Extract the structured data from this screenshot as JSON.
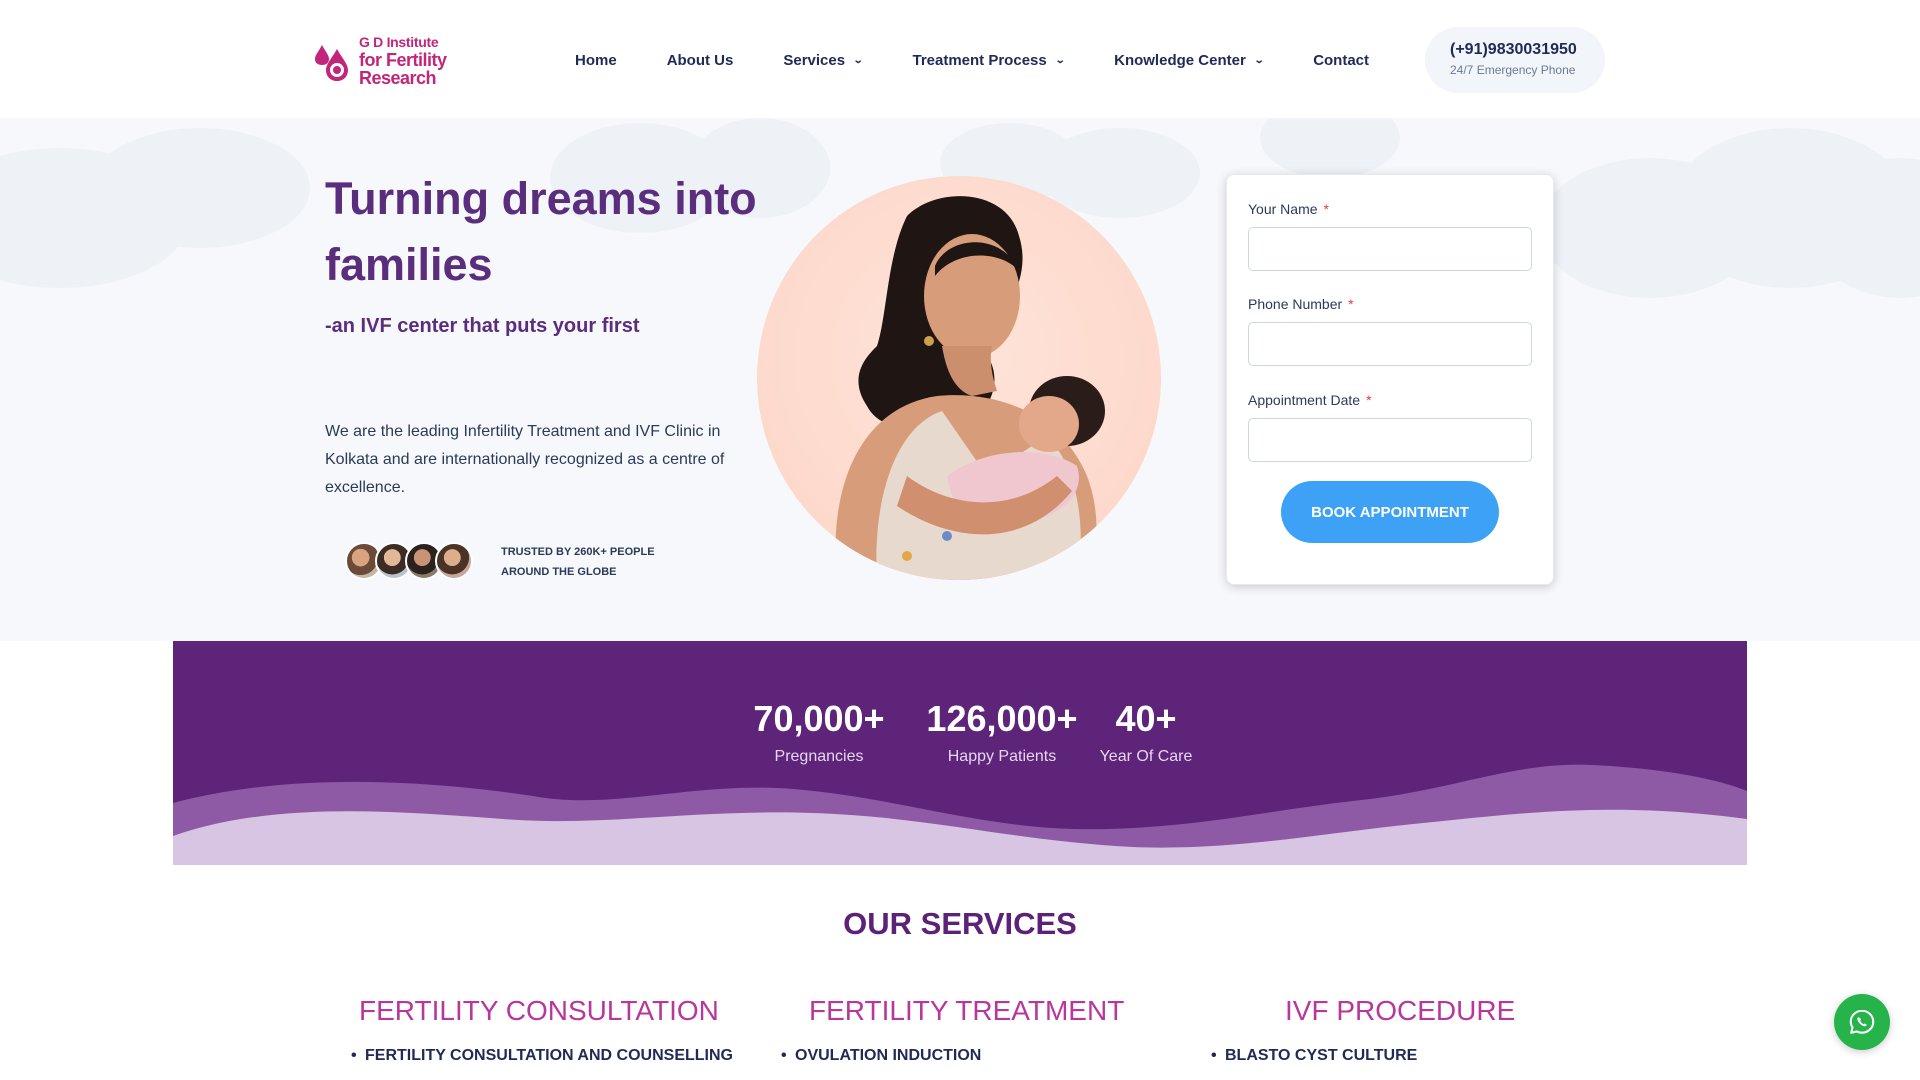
{
  "header": {
    "logo_line1": "G D Institute",
    "logo_line2": "for Fertility Research",
    "nav": [
      {
        "label": "Home"
      },
      {
        "label": "About Us"
      },
      {
        "label": "Services"
      },
      {
        "label": "Treatment Process"
      },
      {
        "label": "Knowledge Center"
      },
      {
        "label": "Contact"
      }
    ],
    "phone": "(+91)9830031950",
    "phone_sub": "24/7 Emergency Phone"
  },
  "hero": {
    "title": "Turning dreams into families",
    "subtitle": "-an IVF center that puts your first",
    "description": "We are the leading Infertility Treatment and IVF Clinic in Kolkata and are internationally recognized as a centre of excellence.",
    "trusted": "TRUSTED BY 260K+ PEOPLE AROUND THE GLOBE"
  },
  "form": {
    "name_label": "Your Name",
    "phone_label": "Phone Number",
    "date_label": "Appointment Date",
    "required_mark": "*",
    "name_value": "",
    "phone_value": "",
    "date_value": "",
    "button": "BOOK APPOINTMENT"
  },
  "stats": [
    {
      "number": "70,000+",
      "label": "Pregnancies"
    },
    {
      "number": "126,000+",
      "label": "Happy Patients"
    },
    {
      "number": "40+",
      "label": "Year Of Care"
    }
  ],
  "services": {
    "title": "OUR SERVICES",
    "columns": [
      {
        "heading": "FERTILITY CONSULTATION",
        "first_item": "FERTILITY CONSULTATION AND COUNSELLING"
      },
      {
        "heading": "FERTILITY TREATMENT",
        "first_item": "OVULATION INDUCTION"
      },
      {
        "heading": "IVF PROCEDURE",
        "first_item": "BLASTO CYST CULTURE"
      }
    ]
  },
  "colors": {
    "brand_purple": "#5e2479",
    "title_purple": "#5b2d7d",
    "service_pink": "#b8379b",
    "button_blue": "#3da1f5",
    "logo_pink": "#c2267a",
    "whatsapp_green": "#25b34a"
  },
  "icons": {
    "logo": "droplet-logo-icon",
    "dropdown": "chevron-down-icon",
    "whatsapp": "whatsapp-icon"
  }
}
